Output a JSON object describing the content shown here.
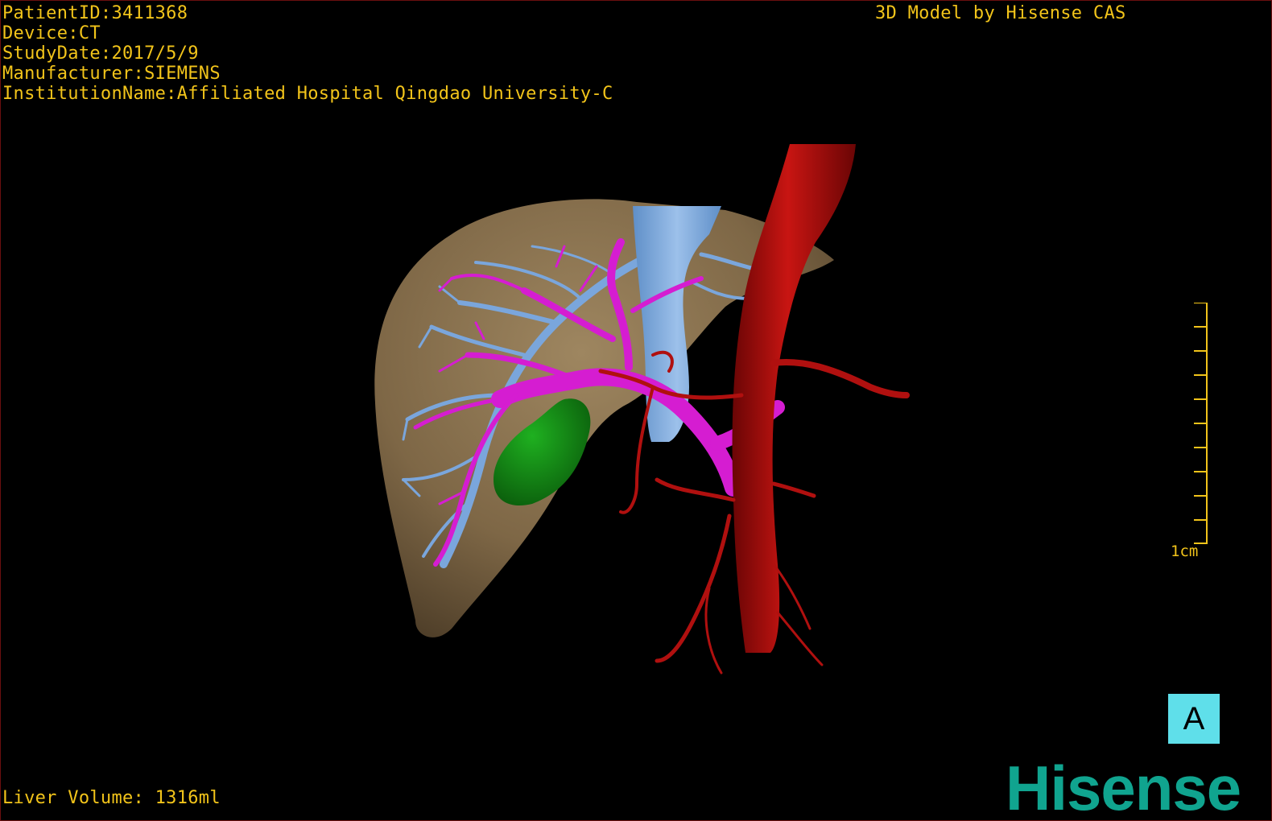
{
  "study_info": {
    "patient_id": "PatientID:3411368",
    "device": "Device:CT",
    "study_date": "StudyDate:2017/5/9",
    "manufacturer": "Manufacturer:SIEMENS",
    "institution": "InstitutionName:Affiliated Hospital Qingdao University-C"
  },
  "model_credit": "3D Model by Hisense CAS",
  "liver_volume": "Liver Volume: 1316ml",
  "scale": {
    "label": "1cm",
    "tick_count": 10,
    "color": "#f2c41a"
  },
  "orientation": {
    "label": "A",
    "color": "#5fdfea"
  },
  "brand": "Hisense",
  "colors": {
    "text": "#f2c41a",
    "liver": "#8a7352",
    "hepatic_vein": "#7aa6dc",
    "portal_vein": "#d51dd1",
    "artery": "#b0100f",
    "gallbladder": "#148a16",
    "brand": "#10a48f"
  }
}
